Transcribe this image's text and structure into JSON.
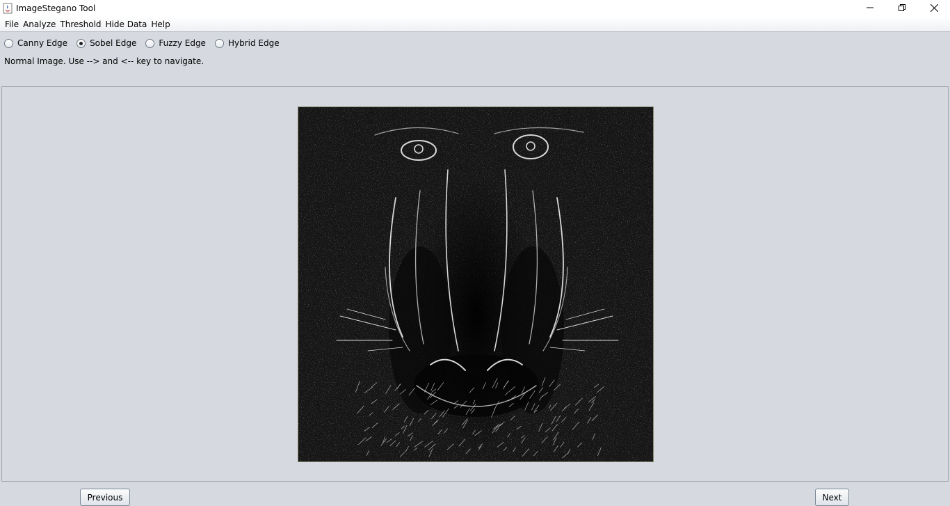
{
  "window": {
    "title": "ImageStegano Tool",
    "controls": {
      "minimize": "─",
      "restore": "❐",
      "close": "✕"
    }
  },
  "menu": {
    "items": [
      "File",
      "Analyze",
      "Threshold",
      "Hide Data",
      "Help"
    ]
  },
  "edge_options": {
    "items": [
      {
        "label": "Canny Edge",
        "checked": false
      },
      {
        "label": "Sobel Edge",
        "checked": true
      },
      {
        "label": "Fuzzy Edge",
        "checked": false
      },
      {
        "label": "Hybrid Edge",
        "checked": false
      }
    ]
  },
  "status": {
    "text": "Normal Image. Use --> and <-- key to navigate."
  },
  "image": {
    "subject": "Sobel edge-detected image of a mandrill face"
  },
  "buttons": {
    "previous": "Previous",
    "next": "Next"
  }
}
